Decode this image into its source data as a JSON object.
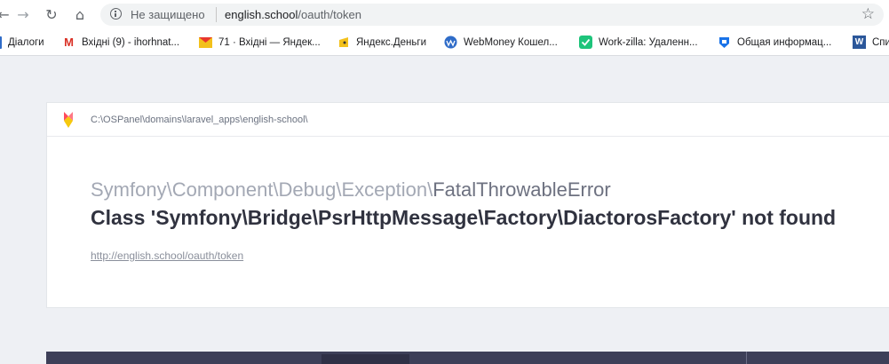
{
  "browser": {
    "security_text": "Не защищено",
    "url_host": "english.school",
    "url_path": "/oauth/token"
  },
  "bookmarks": [
    {
      "label": "Діалоги",
      "icon": "chat-icon"
    },
    {
      "label": "Вхідні (9) - ihorhnat...",
      "icon": "gmail-icon"
    },
    {
      "label": "71 · Вхідні — Яндек...",
      "icon": "yandex-mail-icon"
    },
    {
      "label": "Яндекс.Деньги",
      "icon": "yandex-money-icon"
    },
    {
      "label": "WebMoney Кошел...",
      "icon": "webmoney-icon"
    },
    {
      "label": "Work-zilla: Удаленн...",
      "icon": "workzilla-icon"
    },
    {
      "label": "Общая информац...",
      "icon": "shield-icon"
    },
    {
      "label": "Спи",
      "icon": "word-icon"
    }
  ],
  "error_page": {
    "path": "C:\\OSPanel\\domains\\laravel_apps\\english-school\\",
    "exception_namespace": "Symfony\\Component\\Debug\\Exception\\",
    "exception_name": "FatalThrowableError",
    "message": "Class 'Symfony\\Bridge\\PsrHttpMessage\\Factory\\DiactorosFactory' not found",
    "url": "http://english.school/oauth/token"
  },
  "colors": {
    "accent_dark": "#3d3f58",
    "gmail_red": "#d93025",
    "workzilla_green": "#1ec47b",
    "webmoney_blue": "#2f6cc8"
  }
}
